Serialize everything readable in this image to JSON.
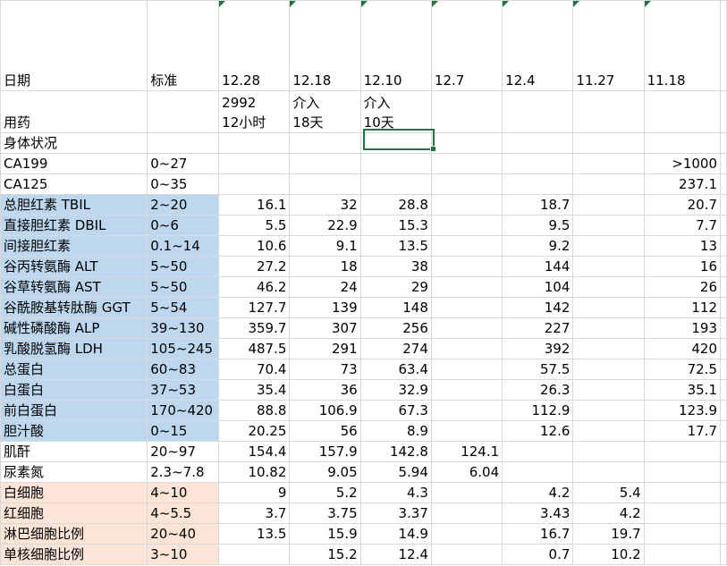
{
  "sheet": {
    "header": {
      "label": "日期",
      "standard": "标准",
      "dates": [
        "12.28",
        "12.18",
        "12.10",
        "12.7",
        "12.4",
        "11.27",
        "11.18"
      ]
    },
    "drug": {
      "label": "用药",
      "values": [
        "2992\n12小时",
        "介入\n18天",
        "介入\n10天",
        "",
        "",
        "",
        ""
      ]
    },
    "status": {
      "label": "身体状况",
      "values": [
        "",
        "",
        "",
        "",
        "",
        "",
        ""
      ]
    },
    "rows": [
      {
        "name": "CA199",
        "standard": "0~27",
        "category": "none",
        "values": [
          "",
          "",
          "",
          "",
          "",
          "",
          ">1000"
        ]
      },
      {
        "name": "CA125",
        "standard": "0~35",
        "category": "none",
        "values": [
          "",
          "",
          "",
          "",
          "",
          "",
          "237.1"
        ]
      },
      {
        "name": "总胆红素 TBIL",
        "standard": "2~20",
        "category": "blue",
        "values": [
          "16.1",
          "32",
          "28.8",
          "",
          "18.7",
          "",
          "20.7"
        ]
      },
      {
        "name": "直接胆红素 DBIL",
        "standard": "0~6",
        "category": "blue",
        "values": [
          "5.5",
          "22.9",
          "15.3",
          "",
          "9.5",
          "",
          "7.7"
        ]
      },
      {
        "name": "间接胆红素",
        "standard": "0.1~14",
        "category": "blue",
        "values": [
          "10.6",
          "9.1",
          "13.5",
          "",
          "9.2",
          "",
          "13"
        ]
      },
      {
        "name": "谷丙转氨酶 ALT",
        "standard": "5~50",
        "category": "blue",
        "values": [
          "27.2",
          "18",
          "38",
          "",
          "144",
          "",
          "16"
        ]
      },
      {
        "name": "谷草转氨酶 AST",
        "standard": "5~50",
        "category": "blue",
        "values": [
          "46.2",
          "24",
          "29",
          "",
          "104",
          "",
          "26"
        ]
      },
      {
        "name": "谷酰胺基转肽酶 GGT",
        "standard": "5~54",
        "category": "blue",
        "values": [
          "127.7",
          "139",
          "148",
          "",
          "142",
          "",
          "112"
        ]
      },
      {
        "name": "碱性磷酸酶 ALP",
        "standard": "39~130",
        "category": "blue",
        "values": [
          "359.7",
          "307",
          "256",
          "",
          "227",
          "",
          "193"
        ]
      },
      {
        "name": "乳酸脱氢酶 LDH",
        "standard": "105~245",
        "category": "blue",
        "values": [
          "487.5",
          "291",
          "274",
          "",
          "392",
          "",
          "420"
        ]
      },
      {
        "name": "总蛋白",
        "standard": "60~83",
        "category": "blue",
        "values": [
          "70.4",
          "73",
          "63.4",
          "",
          "57.5",
          "",
          "72.5"
        ]
      },
      {
        "name": "白蛋白",
        "standard": "37~53",
        "category": "blue",
        "values": [
          "35.4",
          "36",
          "32.9",
          "",
          "26.3",
          "",
          "35.1"
        ]
      },
      {
        "name": "前白蛋白",
        "standard": "170~420",
        "category": "blue",
        "values": [
          "88.8",
          "106.9",
          "67.3",
          "",
          "112.9",
          "",
          "123.9"
        ]
      },
      {
        "name": "胆汁酸",
        "standard": "0~15",
        "category": "blue",
        "values": [
          "20.25",
          "56",
          "8.9",
          "",
          "12.6",
          "",
          "17.7"
        ]
      },
      {
        "name": "肌酐",
        "standard": "20~97",
        "category": "none",
        "values": [
          "154.4",
          "157.9",
          "142.8",
          "124.1",
          "",
          "",
          ""
        ]
      },
      {
        "name": "尿素氮",
        "standard": "2.3~7.8",
        "category": "none",
        "values": [
          "10.82",
          "9.05",
          "5.94",
          "6.04",
          "",
          "",
          ""
        ]
      },
      {
        "name": "白细胞",
        "standard": "4~10",
        "category": "peach",
        "values": [
          "9",
          "5.2",
          "4.3",
          "",
          "4.2",
          "5.4",
          ""
        ]
      },
      {
        "name": "红细胞",
        "standard": "4~5.5",
        "category": "peach",
        "values": [
          "3.7",
          "3.75",
          "3.37",
          "",
          "3.43",
          "4.2",
          ""
        ]
      },
      {
        "name": "淋巴细胞比例",
        "standard": "20~40",
        "category": "peach",
        "values": [
          "13.5",
          "15.9",
          "14.9",
          "",
          "16.7",
          "19.7",
          ""
        ]
      },
      {
        "name": "单核细胞比例",
        "standard": "3~10",
        "category": "peach",
        "values": [
          "",
          "15.2",
          "12.4",
          "",
          "0.7",
          "10.2",
          ""
        ]
      }
    ],
    "colors": {
      "blue_fill": "#bdd7ee",
      "peach_fill": "#fce4d6",
      "grid_line": "#d9d9d9",
      "selection": "#217346"
    }
  }
}
